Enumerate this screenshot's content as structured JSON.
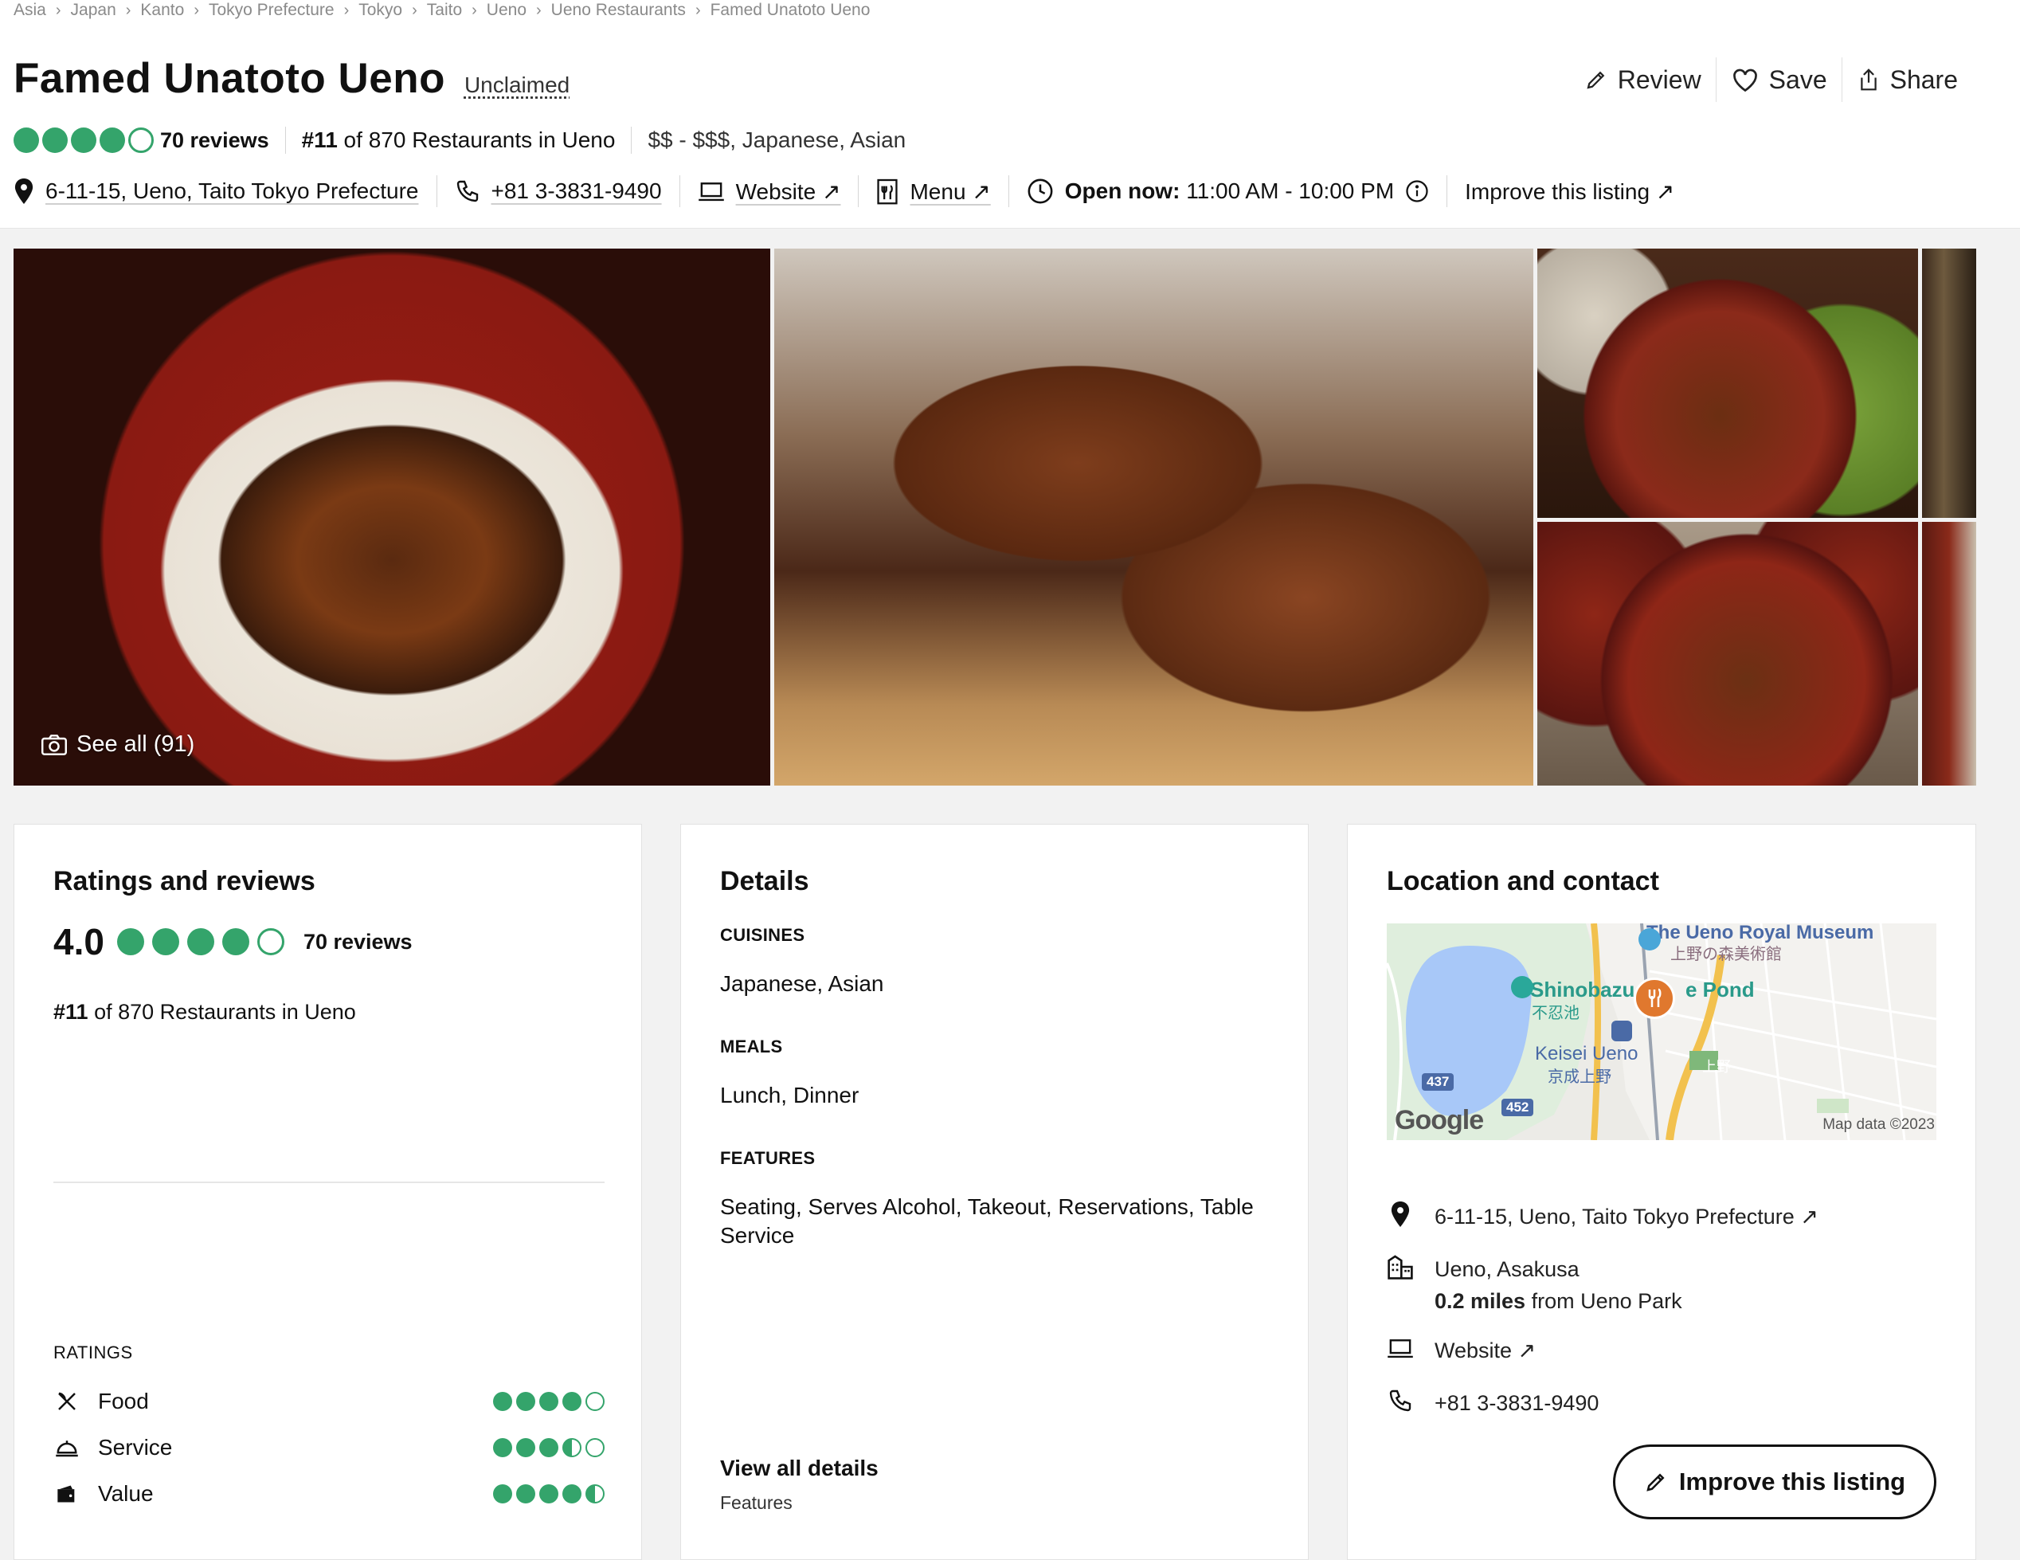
{
  "breadcrumb": [
    "Asia",
    "Japan",
    "Kanto",
    "Tokyo Prefecture",
    "Tokyo",
    "Taito",
    "Ueno",
    "Ueno Restaurants",
    "Famed Unatoto Ueno"
  ],
  "header": {
    "title": "Famed Unatoto Ueno",
    "claim_status": "Unclaimed",
    "actions": {
      "review": "Review",
      "save": "Save",
      "share": "Share"
    }
  },
  "summary": {
    "bubble_rating": 4,
    "reviews": "70 reviews",
    "rank_prefix": "#11",
    "rank_suffix": " of 870 Restaurants in Ueno",
    "price_cuisine": "$$ - $$$, Japanese, Asian"
  },
  "info": {
    "address": "6-11-15, Ueno, Taito Tokyo Prefecture",
    "phone": "+81 3-3831-9490",
    "website": "Website ↗",
    "menu": "Menu ↗",
    "open_label": "Open now:",
    "hours": "11:00 AM - 10:00 PM",
    "improve": "Improve this listing ↗"
  },
  "gallery": {
    "see_all": "See all (91)"
  },
  "ratings_card": {
    "title": "Ratings and reviews",
    "score": "4.0",
    "reviews": "70 reviews",
    "rank_prefix": "#11",
    "rank_suffix": " of 870 Restaurants in Ueno",
    "ratings_label": "RATINGS",
    "categories": [
      {
        "label": "Food",
        "icon": "utensils-icon",
        "score": 4.0
      },
      {
        "label": "Service",
        "icon": "service-bell-icon",
        "score": 3.5
      },
      {
        "label": "Value",
        "icon": "wallet-icon",
        "score": 4.5
      }
    ]
  },
  "details_card": {
    "title": "Details",
    "cuisines_label": "CUISINES",
    "cuisines": "Japanese, Asian",
    "meals_label": "MEALS",
    "meals": "Lunch, Dinner",
    "features_label": "FEATURES",
    "features": "Seating, Serves Alcohol, Takeout, Reservations, Table Service",
    "view_all": "View all details",
    "view_all_sub": "Features"
  },
  "location_card": {
    "title": "Location and contact",
    "map": {
      "museum": "The Ueno Royal Museum",
      "museum_jp": "上野の森美術館",
      "pond": "Shinobazu",
      "pond_jp": "不忍池",
      "pond_suffix": "e Pond",
      "station": "Keisei Ueno",
      "station_jp": "京成上野",
      "ueno_jp": "上野",
      "route_437": "437",
      "route_452": "452",
      "google": "Google",
      "map_data": "Map data ©2023"
    },
    "address": "6-11-15, Ueno, Taito Tokyo Prefecture ↗",
    "neighborhood": "Ueno, Asakusa",
    "distance_bold": "0.2 miles",
    "distance_rest": " from Ueno Park",
    "website": "Website ↗",
    "phone": "+81 3-3831-9490",
    "improve_button": "Improve this listing"
  },
  "colors": {
    "bubble_green": "#34a46b",
    "text": "#111111",
    "muted": "#8a8a8a"
  }
}
